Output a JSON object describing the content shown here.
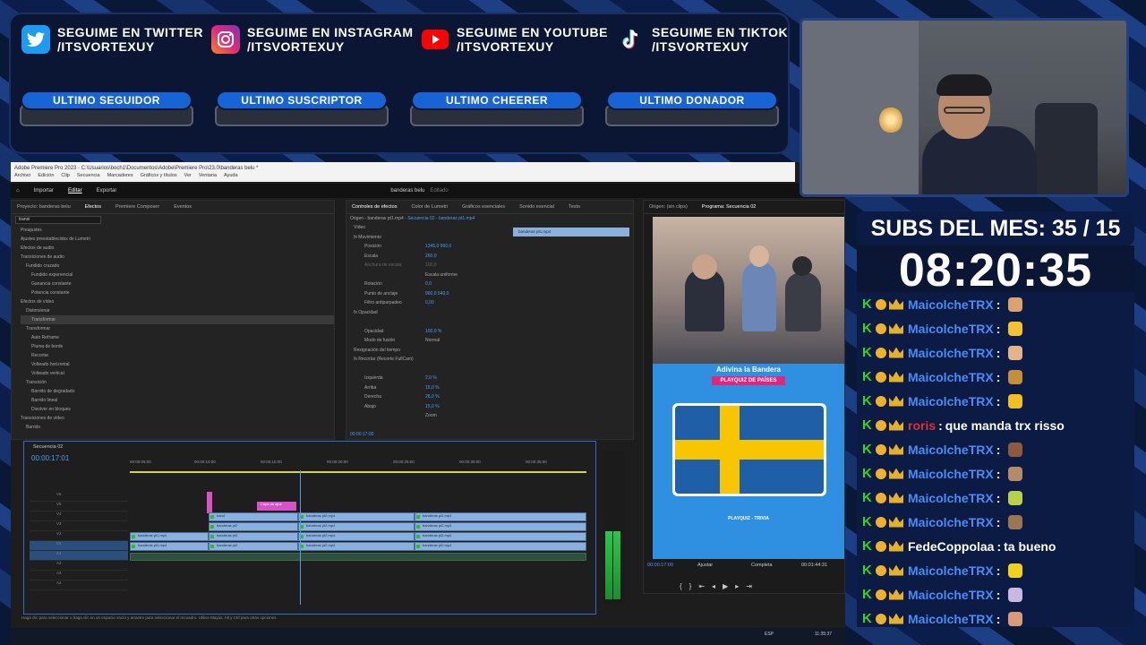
{
  "social": [
    {
      "line1": "SEGUIME EN TWITTER",
      "line2": "/ITSVORTEXUY",
      "icon": "twitter-icon",
      "color": "#1d9bf0",
      "pill": "ULTIMO SEGUIDOR"
    },
    {
      "line1": "SEGUIME EN INSTAGRAM",
      "line2": "/ITSVORTEXUY",
      "icon": "instagram-icon",
      "color": "#d6249f",
      "pill": "ULTIMO SUSCRIPTOR"
    },
    {
      "line1": "SEGUIME EN YOUTUBE",
      "line2": "/ITSVORTEXUY",
      "icon": "youtube-icon",
      "color": "#ff0000",
      "pill": "ULTIMO CHEERER"
    },
    {
      "line1": "SEGUIME EN TIKTOK",
      "line2": "/ITSVORTEXUY",
      "icon": "tiktok-icon",
      "color": "#000000",
      "pill": "ULTIMO DONADOR"
    }
  ],
  "premiere": {
    "title": "Adobe Premiere Pro 2023 - C:\\Usuarios\\boch1\\Documentos\\Adobe\\Premiere Pro\\23.0\\banderas belu *",
    "menu": [
      "Archivo",
      "Edición",
      "Clip",
      "Secuencia",
      "Marcadores",
      "Gráficos y títulos",
      "Ver",
      "Ventana",
      "Ayuda"
    ],
    "workspace_tabs": [
      "Importar",
      "Editar",
      "Exportar"
    ],
    "project_name": "banderas belu",
    "project_status": "Editado",
    "effects_tabs": [
      "Proyecto: banderas belu",
      "Efectos",
      "Premiere Composer",
      "Eventos"
    ],
    "effects_search": "transi",
    "effects_tree": [
      "Preajustes",
      "Ajustes preestablecidos de Lumetri",
      "Efectos de audio",
      "Transiciones de audio",
      "Fundido cruzado",
      "Fundido exponencial",
      "Ganancia constante",
      "Potencia constante",
      "Efectos de vídeo",
      "Distorsionar",
      "Transformar",
      "Transformar",
      "Auto Reframe",
      "Pluma de borde",
      "Recortar",
      "Volteado horizontal",
      "Volteado vertical",
      "Transición",
      "Barrido de degradado",
      "Barrido lineal",
      "Disolver en bloques",
      "Transiciones de vídeo",
      "Barrido"
    ],
    "controls_tabs": [
      "Controles de efectos",
      "Color de Lumetri",
      "Gráficos esenciales",
      "Sonido esencial",
      "Texto"
    ],
    "controls_source": "Origen - banderas pt1.mp4",
    "controls_seq": "Secuencia 02 - banderas pt1.mp4",
    "controls_rows": [
      {
        "label": "Vídeo",
        "value": ""
      },
      {
        "label": "fx Movimiento",
        "value": ""
      },
      {
        "label": "Posición",
        "value": "1345,0   960,0"
      },
      {
        "label": "Escala",
        "value": "260,0"
      },
      {
        "label": "Anchura de escala",
        "value": "100,0"
      },
      {
        "label": "",
        "value": "Escala uniforme"
      },
      {
        "label": "Rotación",
        "value": "0,0"
      },
      {
        "label": "Punto de anclaje",
        "value": "960,0   540,0"
      },
      {
        "label": "Filtro antiparpadeo",
        "value": "0,00"
      },
      {
        "label": "fx Opacidad",
        "value": ""
      },
      {
        "label": "",
        "value": ""
      },
      {
        "label": "Opacidad",
        "value": "100,0 %"
      },
      {
        "label": "Modo de fusión",
        "value": "Normal"
      },
      {
        "label": "Resignación del tiempo",
        "value": ""
      },
      {
        "label": "fx Recortar (Recorte FullCam)",
        "value": ""
      },
      {
        "label": "",
        "value": ""
      },
      {
        "label": "Izquierda",
        "value": "2,0 %"
      },
      {
        "label": "Arriba",
        "value": "15,0 %"
      },
      {
        "label": "Derecha",
        "value": "28,0 %"
      },
      {
        "label": "Abajo",
        "value": "15,0 %"
      },
      {
        "label": "",
        "value": "Zoom"
      }
    ],
    "controls_clip": "banderas pt1.mp4",
    "controls_time": "00:00:17:00",
    "source_tab": "Origen: (sin clips)",
    "program_tab": "Programa: Secuencia 02",
    "program_time": "00:00:17:00",
    "program_fit": "Ajustar",
    "program_quality": "Completa",
    "program_duration": "00:01:44:31",
    "quiz_title": "Adivina la Bandera",
    "quiz_sub": "PLAYQUIZ DE PAÍSES",
    "quiz_channel": "PLAYQUIZ - TRIVIA",
    "seq_tab": "Secuencia 02",
    "seq_time": "00:00:17:01",
    "ruler": [
      "00:00:05:00",
      "00:00:10:00",
      "00:00:15:00",
      "00:00:20:00",
      "00:00:25:00",
      "00:00:30:00",
      "00:00:35:00"
    ],
    "tracks": [
      "V6",
      "V5",
      "V4",
      "V3",
      "V2",
      "V1",
      "A1",
      "A2",
      "A3",
      "A4"
    ],
    "clip_labels": {
      "title_clip": "Capa de ajus",
      "a": "banderas pt2.mp4",
      "b": "banderas pt1.mp4",
      "c": "banderas pt1.mp4",
      "d": "band",
      "e": "banderas pt2"
    },
    "meter_scale": [
      "0",
      "-6",
      "-12",
      "-18",
      "-24",
      "-30",
      "-36",
      "-42",
      "-48",
      "-54"
    ],
    "status": "Haga clic para seleccionar o haga clic en un espacio vacío y arrastre para seleccionar el recuadro. Utilice Mayús, Alt y Ctrl para otras opciones."
  },
  "taskbar": {
    "time": "11:35:37",
    "lang": "ESP"
  },
  "subs": "SUBS DEL MES: 35 / 15",
  "timer": "08:20:35",
  "chat": [
    {
      "user": "MaicolcheTRX",
      "msg": "",
      "color": "#4a8cf7",
      "emote": "#d9a36b"
    },
    {
      "user": "MaicolcheTRX",
      "msg": "",
      "color": "#4a8cf7",
      "emote": "#f2c230"
    },
    {
      "user": "MaicolcheTRX",
      "msg": "",
      "color": "#4a8cf7",
      "emote": "#e2b48a"
    },
    {
      "user": "MaicolcheTRX",
      "msg": "",
      "color": "#4a8cf7",
      "emote": "#c58f3a"
    },
    {
      "user": "MaicolcheTRX",
      "msg": "",
      "color": "#4a8cf7",
      "emote": "#f0c020"
    },
    {
      "user": "roris",
      "msg": "que manda trx risso",
      "color": "#e03030",
      "emote": ""
    },
    {
      "user": "MaicolcheTRX",
      "msg": "",
      "color": "#4a8cf7",
      "emote": "#8a5b3d"
    },
    {
      "user": "MaicolcheTRX",
      "msg": "",
      "color": "#4a8cf7",
      "emote": "#b58a66"
    },
    {
      "user": "MaicolcheTRX",
      "msg": "",
      "color": "#4a8cf7",
      "emote": "#b8d04a"
    },
    {
      "user": "MaicolcheTRX",
      "msg": "",
      "color": "#4a8cf7",
      "emote": "#9c7654"
    },
    {
      "user": "FedeCoppolaa",
      "msg": "ta bueno",
      "color": "#ffffff",
      "emote": ""
    },
    {
      "user": "MaicolcheTRX",
      "msg": "",
      "color": "#4a8cf7",
      "emote": "#f1d11a"
    },
    {
      "user": "MaicolcheTRX",
      "msg": "",
      "color": "#4a8cf7",
      "emote": "#c9b8e0"
    },
    {
      "user": "MaicolcheTRX",
      "msg": "",
      "color": "#4a8cf7",
      "emote": "#d99a7a"
    }
  ]
}
